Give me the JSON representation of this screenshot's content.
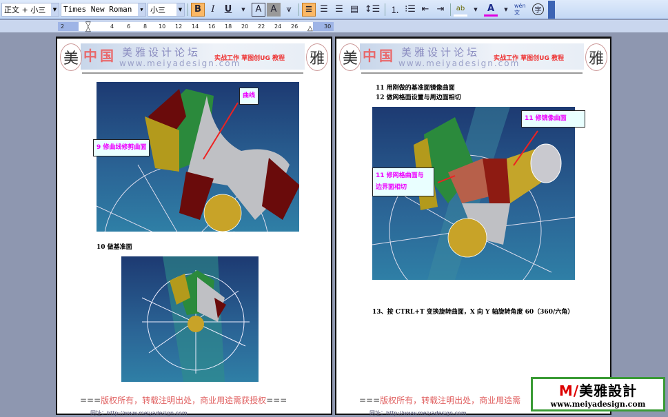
{
  "toolbar": {
    "style": "正文 + 小三",
    "font": "Times New Roman",
    "size": "小三",
    "buttons": [
      {
        "name": "bold",
        "glyph": "B",
        "active": true
      },
      {
        "name": "italic",
        "glyph": "I"
      },
      {
        "name": "underline",
        "glyph": "U"
      },
      {
        "name": "char-border",
        "glyph": "A"
      },
      {
        "name": "char-shading",
        "glyph": "A"
      },
      {
        "name": "emphasis",
        "glyph": "⩛"
      }
    ],
    "align": [
      {
        "name": "justify",
        "glyph": "≣",
        "active": true
      },
      {
        "name": "center",
        "glyph": "☰"
      },
      {
        "name": "right",
        "glyph": "☰"
      },
      {
        "name": "distributed",
        "glyph": "▤"
      },
      {
        "name": "line-spacing",
        "glyph": "↕☰"
      }
    ],
    "lists": [
      {
        "name": "numbering",
        "glyph": "⒈"
      },
      {
        "name": "bullets",
        "glyph": "⁝☰"
      },
      {
        "name": "decrease-indent",
        "glyph": "⇤"
      },
      {
        "name": "increase-indent",
        "glyph": "⇥"
      }
    ],
    "highlight": "ab",
    "font_color": "A",
    "phonetic": "wén 文",
    "enclose": "字",
    "highlight_color": "#ffffff",
    "font_color_value": "#e000e0"
  },
  "ruler": {
    "ticks": [
      "2",
      "4",
      "6",
      "8",
      "10",
      "12",
      "14",
      "16",
      "18",
      "20",
      "22",
      "24",
      "26",
      "30"
    ]
  },
  "header": {
    "seal_left": "美",
    "seal_right": "雅",
    "china": "中国",
    "forum": "美雅设计论坛",
    "url": "www.meiyadesign.com",
    "subtitle": "实战工作 草图创UG 教程"
  },
  "left_page": {
    "callouts": [
      "曲线",
      "9 修曲线修剪曲面"
    ],
    "caption": "10 做基准面"
  },
  "right_page": {
    "lines": [
      "11 用刚做的基准面镜像曲面",
      "12 做网格面设置与周边面相切"
    ],
    "callouts": [
      "11 修镜像曲面",
      "11 修网格曲面与",
      "边界面相切"
    ],
    "step13": "13、按 CTRL+T 变换旋转曲面，X 向 Y 轴旋转角度 60（360/六角）"
  },
  "footer": {
    "eq": "===",
    "text": "版权所有，转载注明出处，商业用途需获授权",
    "eq2": "===",
    "text_right": "版权所有，转载注明出处，商业用途需",
    "link": "网址：http://www.meiyadesign.com"
  },
  "logo": {
    "m": "M/",
    "brand": "美雅設計",
    "url": "www.meiyadesign.com"
  }
}
